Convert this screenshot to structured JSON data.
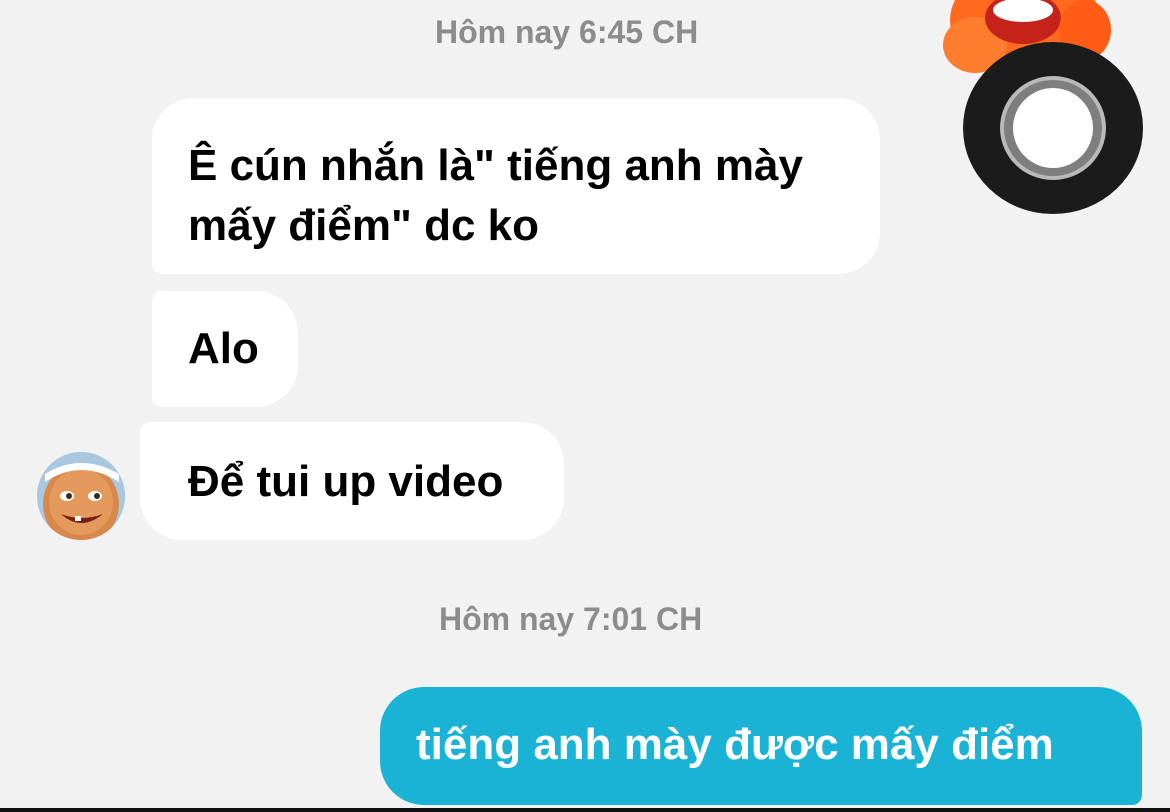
{
  "chat": {
    "timestamp_1": "Hôm nay 6:45 CH",
    "timestamp_2": "Hôm nay 7:01 CH",
    "messages_in": [
      {
        "lines": [
          "Ê cún nhắn là\" tiếng anh mày",
          "mấy điểm\" dc ko"
        ]
      },
      {
        "lines": [
          "Alo"
        ]
      },
      {
        "lines": [
          "Để tui up video"
        ]
      }
    ],
    "message_out": {
      "text": "tiếng anh mày được mấy điểm"
    }
  },
  "colors": {
    "background": "#f2f2f2",
    "incoming_bubble": "#ffffff",
    "outgoing_bubble": "#1ab3d6",
    "timestamp_text": "#8c8c8c",
    "sticker_orange": "#ff6a1f"
  },
  "icons": {
    "avatar": "cartoon-baby-avatar",
    "record": "record-button-icon",
    "sticker": "orange-face-sticker"
  }
}
